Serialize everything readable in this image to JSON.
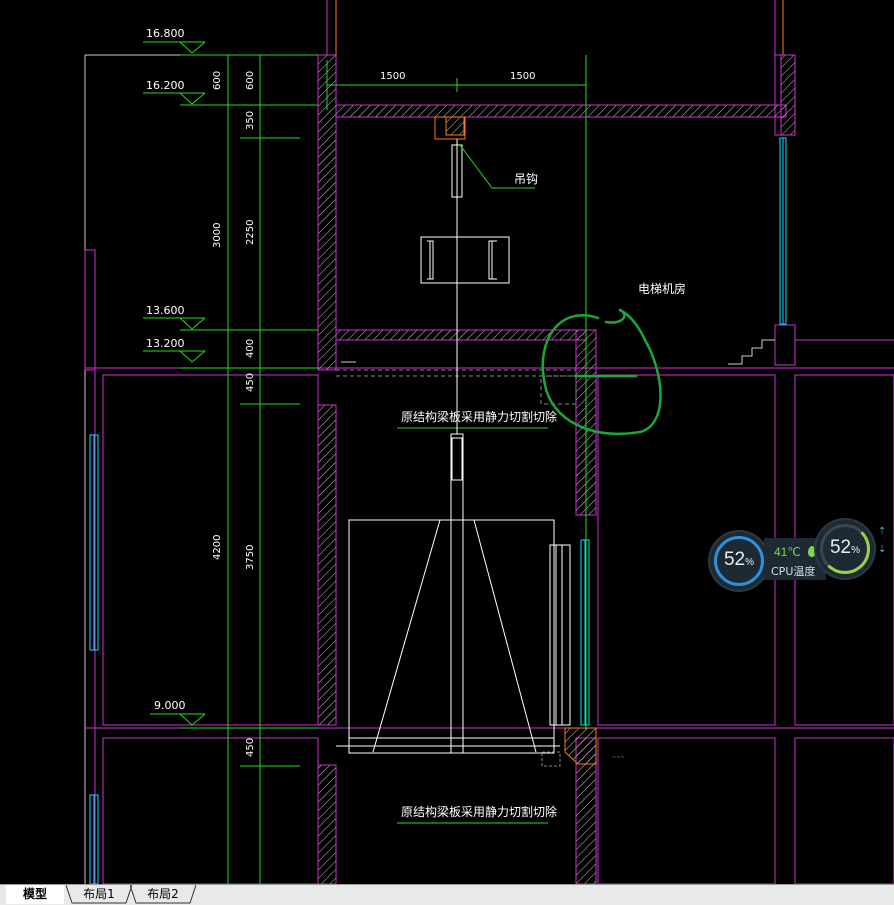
{
  "drawing": {
    "elevations": [
      "16.800",
      "16.200",
      "13.600",
      "13.200",
      "9.000"
    ],
    "dims_col1": [
      "600",
      "350",
      "2250",
      "400",
      "450",
      "3750",
      "450"
    ],
    "dims_col2": [
      "600",
      "3000",
      "4200"
    ],
    "dims_top": [
      "1500",
      "1500"
    ],
    "hook_label": "吊钩",
    "room_label": "电梯机房",
    "cut_note_1": "原结构梁板采用静力切割切除",
    "cut_note_2": "原结构梁板采用静力切割切除"
  },
  "monitor": {
    "cpu_usage": "52",
    "cpu_unit": "%",
    "temp_value": "41℃",
    "temp_label": "CPU温度",
    "mem_usage": "52",
    "mem_unit": "%"
  },
  "tabs": [
    {
      "label": "模型",
      "active": true
    },
    {
      "label": "布局1",
      "active": false
    },
    {
      "label": "布局2",
      "active": false
    }
  ],
  "colors": {
    "background": "#000000",
    "wall": "#d030d0",
    "dimension": "#22dd22",
    "text": "#ffffff",
    "window": "#00e5ff",
    "annotation_circle": "#1aa83a",
    "beam": "#ff7a1a"
  }
}
